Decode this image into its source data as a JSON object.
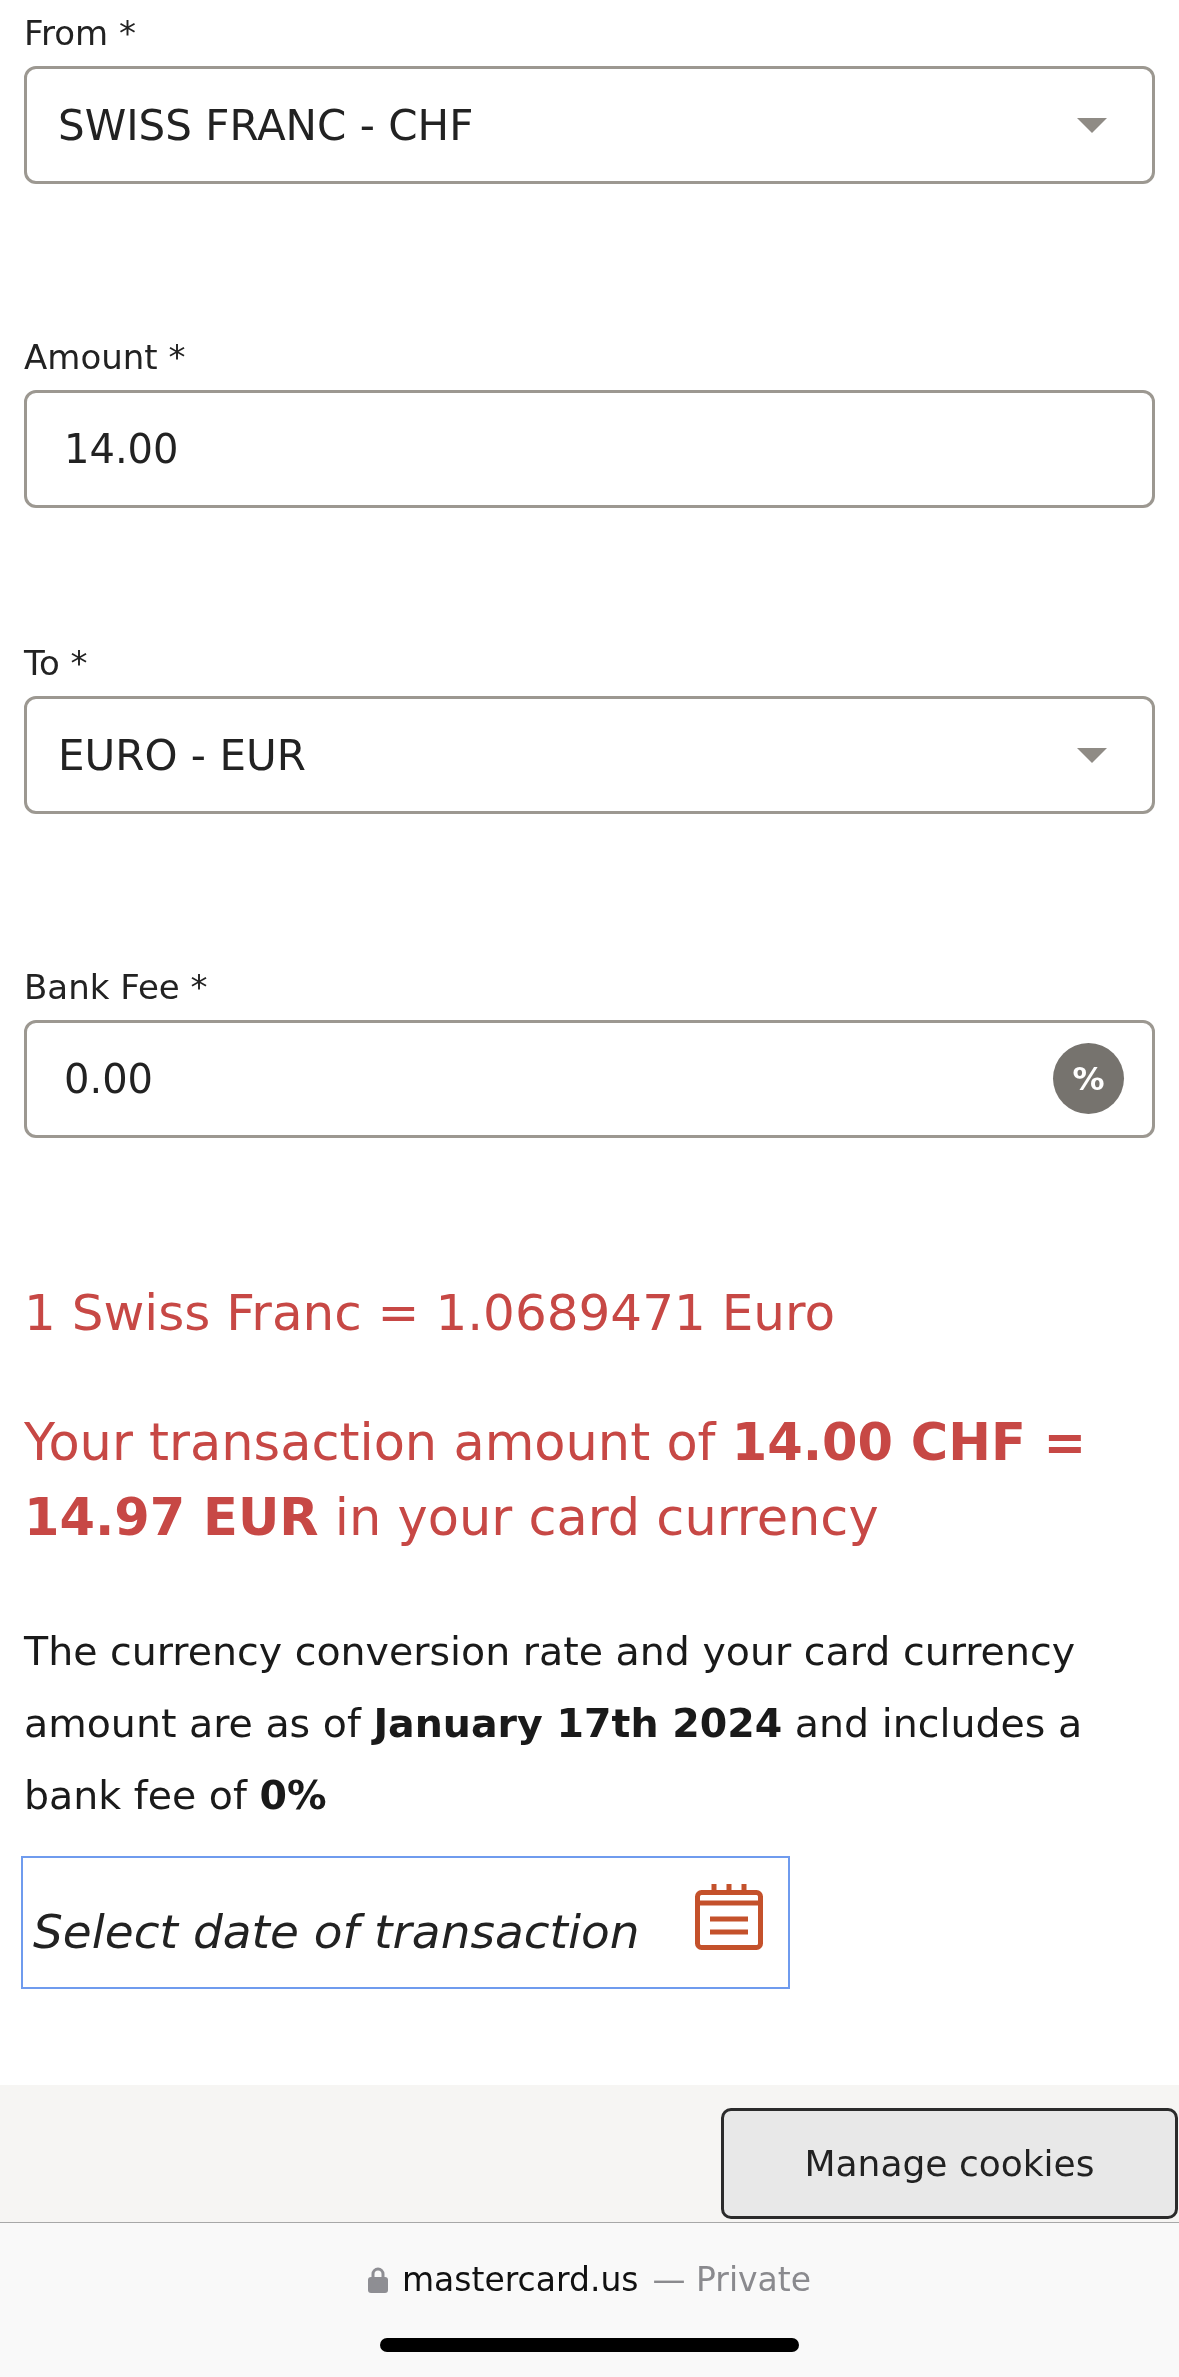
{
  "form": {
    "fields": [
      {
        "kind": "select",
        "label": "From *",
        "value": "SWISS FRANC - CHF"
      },
      {
        "kind": "text",
        "label": "Amount *",
        "value": "14.00"
      },
      {
        "kind": "select",
        "label": "To *",
        "value": "EURO - EUR"
      },
      {
        "kind": "percent",
        "label": "Bank Fee *",
        "value": "0.00",
        "unit": "%"
      }
    ]
  },
  "result": {
    "rate": "1 Swiss Franc = 1.0689471 Euro",
    "conversion": "Your transaction amount of **14.00 CHF = 14.97 EUR** in your card currency",
    "note": "The currency conversion rate and your card currency amount are as of **January 17th 2024** and includes a bank fee of **0%**"
  },
  "date_picker": {
    "placeholder": "Select date of transaction",
    "focused": true
  },
  "cookie_bar": {
    "button": "Manage cookies"
  },
  "browser_bar": {
    "domain": "mastercard.us",
    "label": "— Private"
  }
}
